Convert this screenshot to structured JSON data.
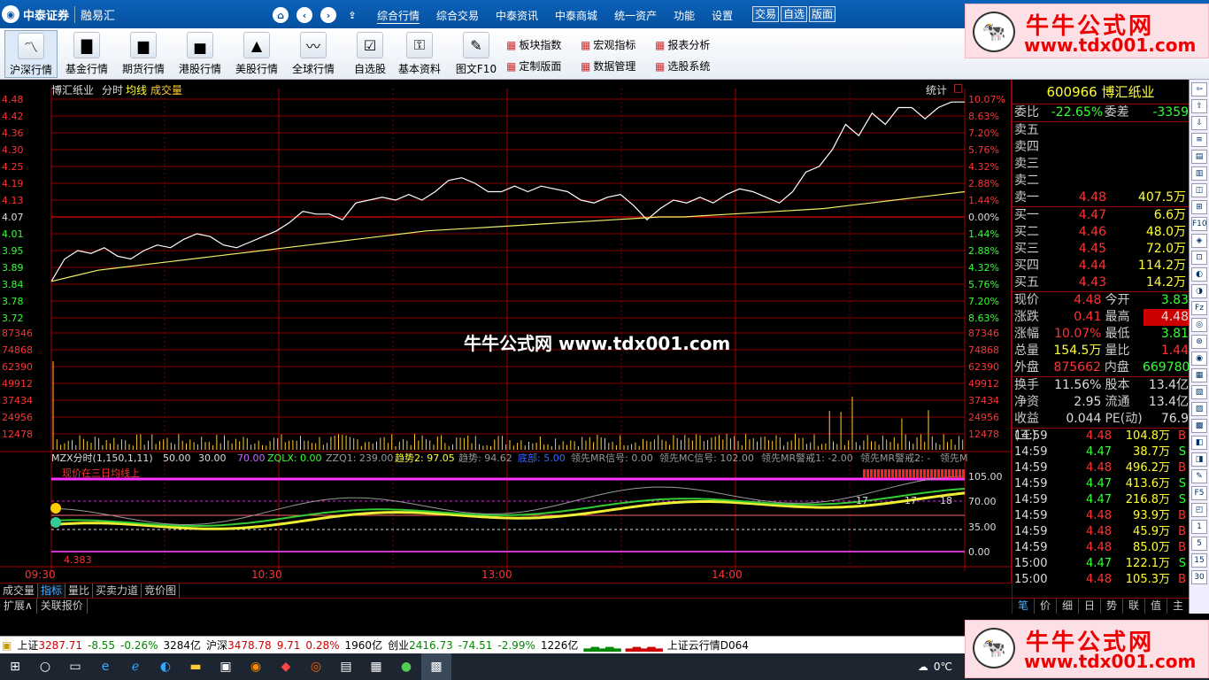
{
  "menubar": {
    "logo": "中泰证券",
    "logo_sub": "融易汇",
    "menus": [
      "综合行情",
      "综合交易",
      "中泰资讯",
      "中泰商城",
      "统一资产",
      "功能",
      "设置"
    ],
    "quick": [
      "交易",
      "自选",
      "版面"
    ]
  },
  "toolbar": {
    "buttons": [
      "沪深行情",
      "基金行情",
      "期货行情",
      "港股行情",
      "美股行情",
      "全球行情",
      "自选股",
      "基本资料",
      "图文F10"
    ],
    "small": [
      "板块指数",
      "宏观指标",
      "报表分析",
      "定制版面",
      "数据管理",
      "选股系统"
    ]
  },
  "chart": {
    "name": "博汇纸业",
    "mode": "分时",
    "legend_avg": "均线",
    "legend_vol": "成交量",
    "stats_btn": "统计",
    "price_axis_left": [
      "4.48",
      "4.42",
      "4.36",
      "4.30",
      "4.25",
      "4.19",
      "4.13",
      "4.07",
      "4.01",
      "3.95",
      "3.89",
      "3.84",
      "3.78",
      "3.72"
    ],
    "pct_axis_right": [
      "10.07%",
      "8.63%",
      "7.20%",
      "5.76%",
      "4.32%",
      "2.88%",
      "1.44%",
      "0.00%",
      "1.44%",
      "2.88%",
      "4.32%",
      "5.76%",
      "7.20%",
      "8.63%"
    ],
    "vol_axis": [
      "87346",
      "74868",
      "62390",
      "49912",
      "37434",
      "24956",
      "12478"
    ],
    "indicator_header": [
      "MZX分时(1,150,1,11)",
      "50.00",
      "30.00",
      "70.00",
      "ZQLX: 0.00",
      "ZZQ1: 239.00",
      "趋势2: 97.05",
      "趋势: 94.62",
      "底部: 5.00",
      "领先MR信号: 0.00",
      "领先MC信号: 102.00",
      "领先MR警戒1: -2.00",
      "领先MR警戒2: -",
      "领先M"
    ],
    "indicator_note": "现价在三日均线上",
    "indicator_axis": [
      "105.00",
      "70.00",
      "35.00",
      "0.00"
    ],
    "indicator_min": "4.383",
    "indicator_marks": [
      "17",
      "17",
      "18"
    ],
    "time_axis": [
      "09:30",
      "10:30",
      "13:00",
      "14:00"
    ],
    "ctrl": [
      "+",
      "-",
      "0"
    ],
    "tabs": [
      "成交量",
      "指标",
      "量比",
      "买卖力道",
      "竞价图"
    ],
    "tabs2": [
      "扩展∧",
      "关联报价"
    ],
    "center_watermark": "牛牛公式网  www.tdx001.com"
  },
  "panel": {
    "code": "600966",
    "name": "博汇纸业",
    "weibi_label": "委比",
    "weibi": "-22.65%",
    "weicha_label": "委差",
    "weicha": "-3359",
    "asks": [
      {
        "label": "卖五",
        "price": "",
        "vol": ""
      },
      {
        "label": "卖四",
        "price": "",
        "vol": ""
      },
      {
        "label": "卖三",
        "price": "",
        "vol": ""
      },
      {
        "label": "卖二",
        "price": "",
        "vol": ""
      },
      {
        "label": "卖一",
        "price": "4.48",
        "vol": "407.5万"
      }
    ],
    "bids": [
      {
        "label": "买一",
        "price": "4.47",
        "vol": "6.6万"
      },
      {
        "label": "买二",
        "price": "4.46",
        "vol": "48.0万"
      },
      {
        "label": "买三",
        "price": "4.45",
        "vol": "72.0万"
      },
      {
        "label": "买四",
        "price": "4.44",
        "vol": "114.2万"
      },
      {
        "label": "买五",
        "price": "4.43",
        "vol": "14.2万"
      }
    ],
    "stats": [
      {
        "l1": "现价",
        "v1": "4.48",
        "c1": "red",
        "l2": "今开",
        "v2": "3.83",
        "c2": "grn"
      },
      {
        "l1": "涨跌",
        "v1": "0.41",
        "c1": "red",
        "l2": "最高",
        "v2": "4.48",
        "c2": "redbox"
      },
      {
        "l1": "涨幅",
        "v1": "10.07%",
        "c1": "red",
        "l2": "最低",
        "v2": "3.81",
        "c2": "grn"
      },
      {
        "l1": "总量",
        "v1": "154.5万",
        "c1": "yel",
        "l2": "量比",
        "v2": "1.44",
        "c2": "red"
      },
      {
        "l1": "外盘",
        "v1": "875662",
        "c1": "red",
        "l2": "内盘",
        "v2": "669780",
        "c2": "grn"
      }
    ],
    "stats2": [
      {
        "l1": "换手",
        "v1": "11.56%",
        "l2": "股本",
        "v2": "13.4亿"
      },
      {
        "l1": "净资",
        "v1": "2.95",
        "l2": "流通",
        "v2": "13.4亿"
      },
      {
        "l1": "收益(三)",
        "v1": "0.044",
        "l2": "PE(动)",
        "v2": "76.9"
      }
    ],
    "ticks": [
      {
        "t": "14:59",
        "p": "4.48",
        "v": "104.8万",
        "s": "B"
      },
      {
        "t": "14:59",
        "p": "4.47",
        "v": "38.7万",
        "s": "S"
      },
      {
        "t": "14:59",
        "p": "4.48",
        "v": "496.2万",
        "s": "B"
      },
      {
        "t": "14:59",
        "p": "4.47",
        "v": "413.6万",
        "s": "S"
      },
      {
        "t": "14:59",
        "p": "4.47",
        "v": "216.8万",
        "s": "S"
      },
      {
        "t": "14:59",
        "p": "4.48",
        "v": "93.9万",
        "s": "B"
      },
      {
        "t": "14:59",
        "p": "4.48",
        "v": "45.9万",
        "s": "B"
      },
      {
        "t": "14:59",
        "p": "4.48",
        "v": "85.0万",
        "s": "B"
      },
      {
        "t": "15:00",
        "p": "4.47",
        "v": "122.1万",
        "s": "S"
      },
      {
        "t": "15:00",
        "p": "4.48",
        "v": "105.3万",
        "s": "B"
      }
    ],
    "tabs": [
      "笔",
      "价",
      "细",
      "日",
      "势",
      "联",
      "值",
      "主"
    ]
  },
  "ricons": [
    "⇦",
    "⇧",
    "⇩",
    "≡",
    "▤",
    "▥",
    "◫",
    "⊞",
    "F10",
    "◈",
    "⊡",
    "◐",
    "◑",
    "Fz",
    "◎",
    "⊛",
    "◉",
    "▦",
    "▧",
    "▨",
    "▩",
    "◧",
    "◨",
    "✎",
    "F5",
    "◰",
    "1",
    "5",
    "15",
    "30"
  ],
  "status": {
    "sh_label": "上证",
    "sh": "3287.71",
    "sh_chg": "-8.55",
    "sh_pct": "-0.26%",
    "sh_amt": "3284亿",
    "sz_label": "沪深",
    "sz": "3478.78",
    "sz_chg": "9.71",
    "sz_pct": "0.28%",
    "sz_amt": "1960亿",
    "cy_label": "创业",
    "cy": "2416.73",
    "cy_chg": "-74.51",
    "cy_pct": "-2.99%",
    "cy_amt": "1226亿",
    "cloud": "上证云行情D064"
  },
  "taskbar": {
    "temp": "0℃"
  },
  "watermark": {
    "t1": "牛牛公式网",
    "t2": "www.tdx001.com"
  }
}
